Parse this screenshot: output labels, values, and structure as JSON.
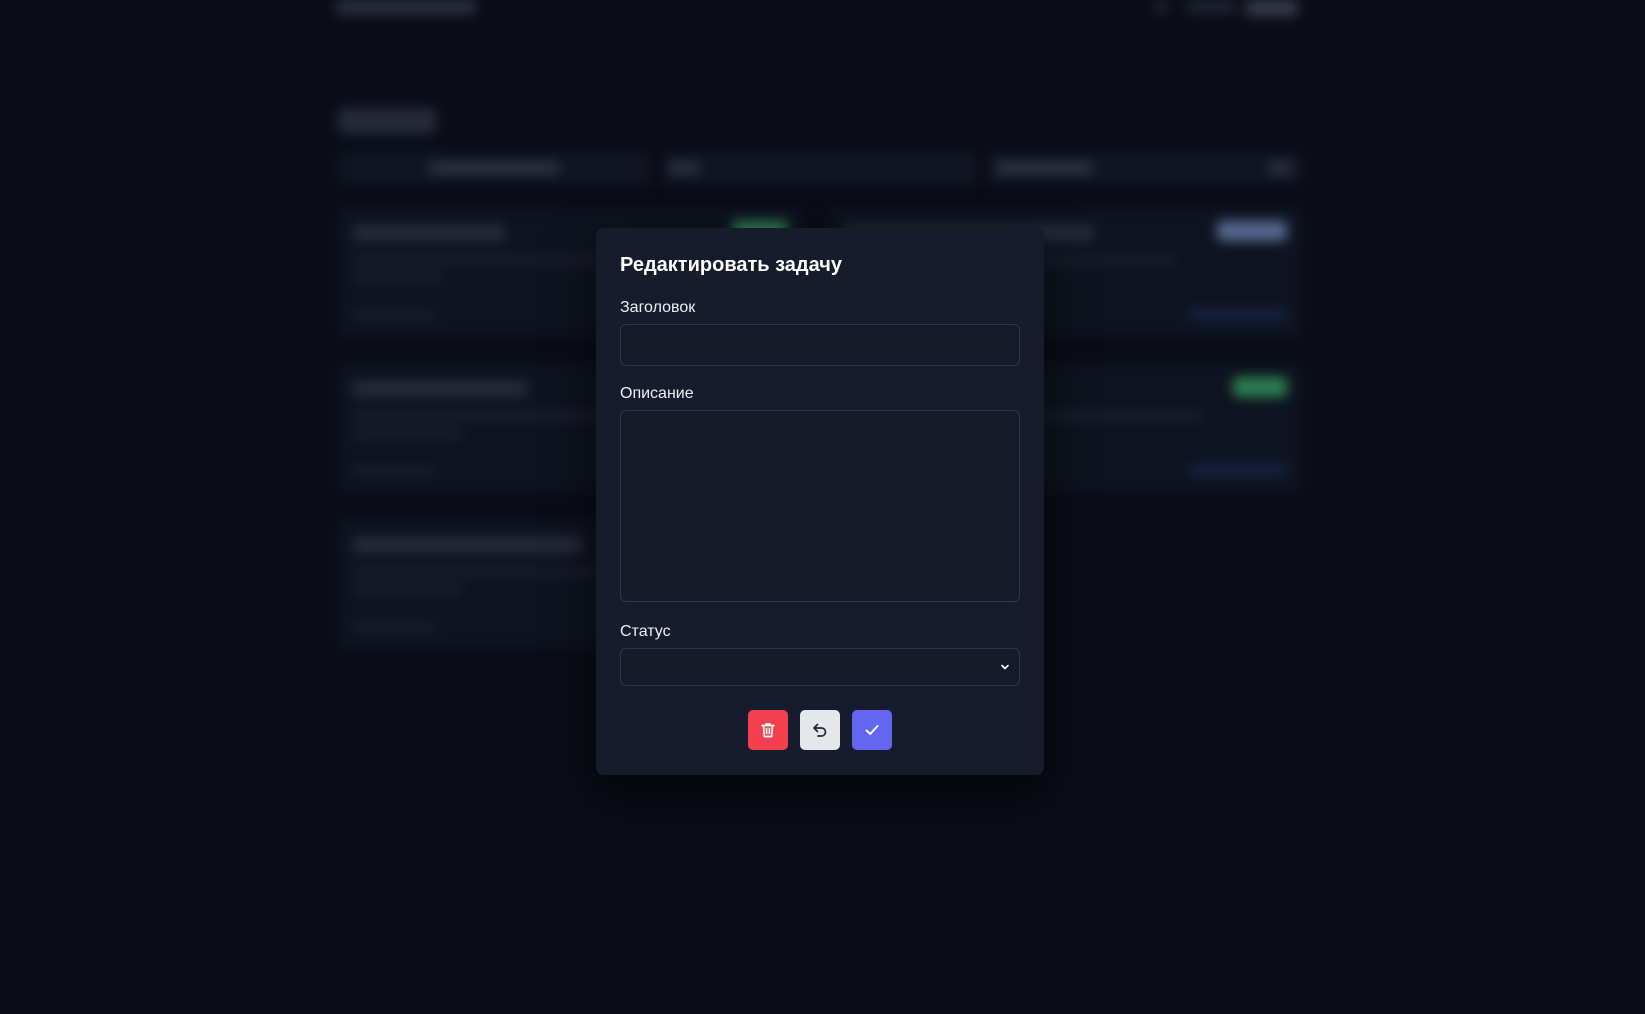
{
  "modal": {
    "title": "Редактировать задачу",
    "fields": {
      "title_label": "Заголовок",
      "title_value": "",
      "description_label": "Описание",
      "description_value": "",
      "status_label": "Статус",
      "status_value": ""
    },
    "actions": {
      "delete_icon": "trash-icon",
      "undo_icon": "undo-icon",
      "save_icon": "check-icon"
    }
  },
  "colors": {
    "background": "#0a0d17",
    "modal_bg": "#161c2b",
    "input_border": "#2d3648",
    "delete": "#f43f4e",
    "undo": "#e5e7eb",
    "save": "#6366f1",
    "badge_green": "#4ade80",
    "badge_blue": "#93b4f5"
  }
}
